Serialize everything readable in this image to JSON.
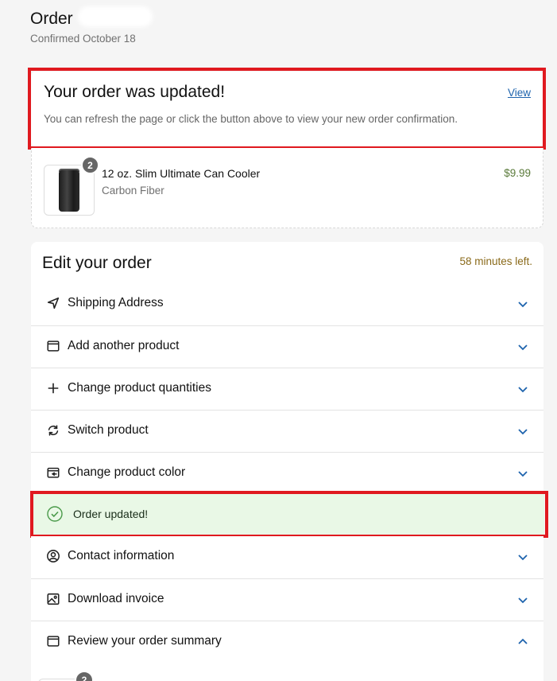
{
  "header": {
    "title": "Order",
    "subtitle": "Confirmed October 18"
  },
  "update_banner": {
    "title": "Your order was updated!",
    "link": "View",
    "message": "You can refresh the page or click the button above to view your new order confirmation."
  },
  "product": {
    "quantity": "2",
    "name": "12 oz. Slim Ultimate Can Cooler",
    "variant": "Carbon Fiber",
    "price": "$9.99"
  },
  "edit": {
    "title": "Edit your order",
    "time_left": "58 minutes left.",
    "rows": [
      {
        "label": "Shipping Address",
        "icon": "navigation-arrow-icon"
      },
      {
        "label": "Add another product",
        "icon": "window-icon"
      },
      {
        "label": "Change product quantities",
        "icon": "plus-icon"
      },
      {
        "label": "Switch product",
        "icon": "refresh-icon"
      },
      {
        "label": "Change product color",
        "icon": "swatch-icon"
      },
      {
        "label": "Contact information",
        "icon": "user-circle-icon"
      },
      {
        "label": "Download invoice",
        "icon": "image-icon"
      },
      {
        "label": "Review your order summary",
        "icon": "window-icon"
      }
    ],
    "success_message": "Order updated!",
    "summary_badge": "2"
  },
  "colors": {
    "highlight_frame": "#e0191f",
    "link": "#1d63ad",
    "chevron": "#1d63ad",
    "success_bg": "#e9f8e6",
    "success_icon": "#4a9a4a",
    "time_left": "#8a6a1a"
  }
}
